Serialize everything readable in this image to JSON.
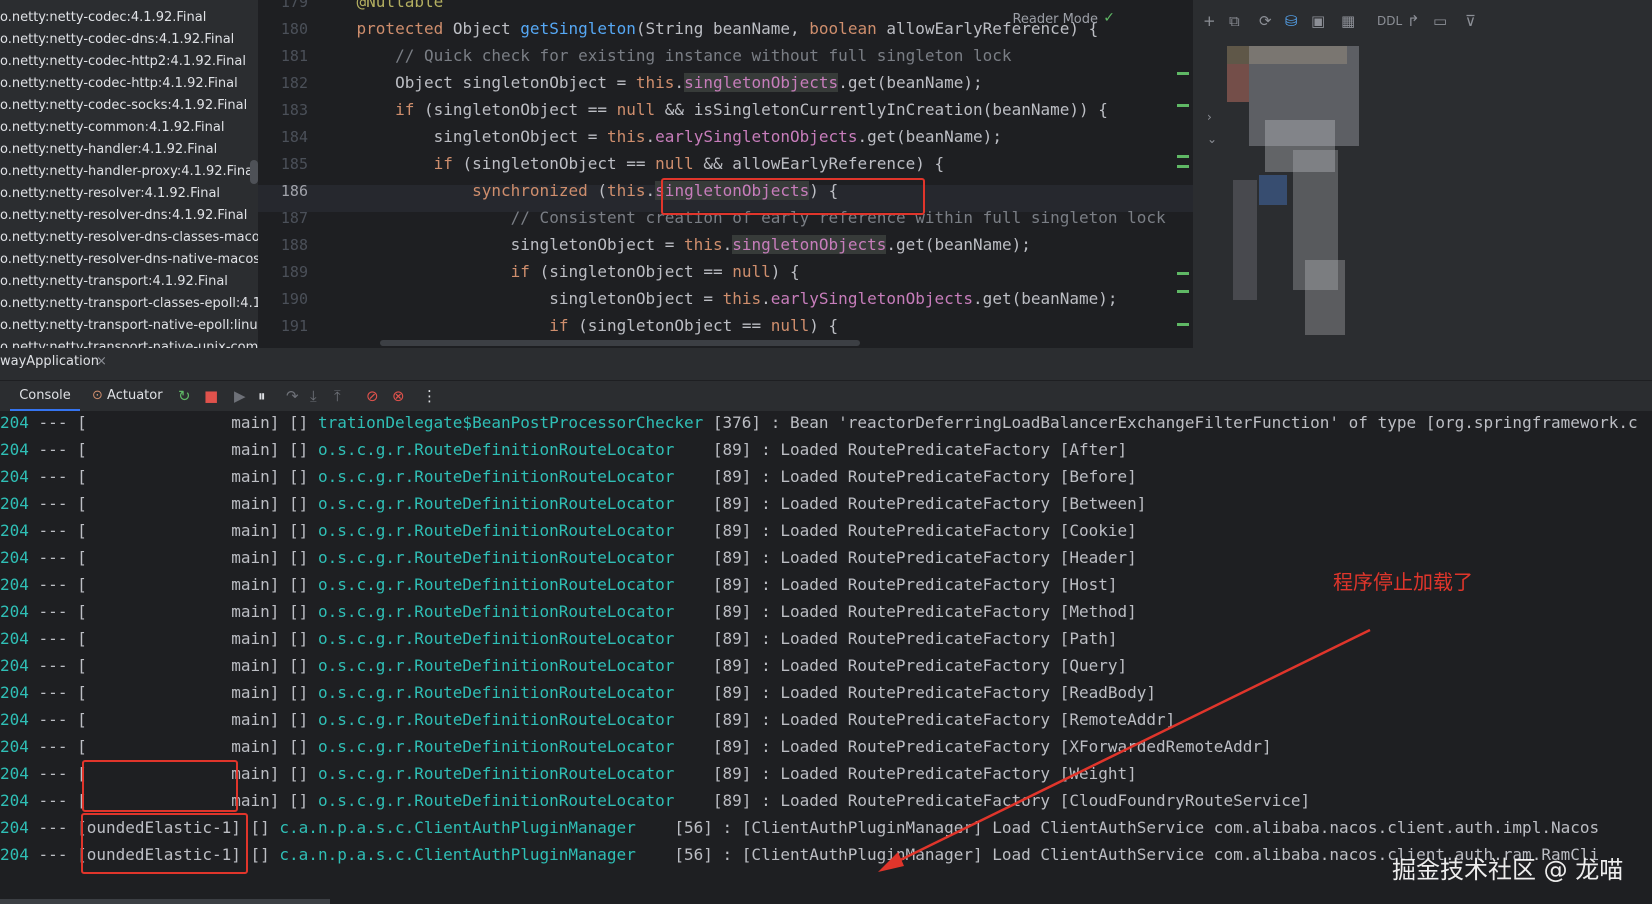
{
  "project_tree": {
    "items": [
      "o.netty:netty-codec:4.1.92.Final",
      "o.netty:netty-codec-dns:4.1.92.Final",
      "o.netty:netty-codec-http2:4.1.92.Final",
      "o.netty:netty-codec-http:4.1.92.Final",
      "o.netty:netty-codec-socks:4.1.92.Final",
      "o.netty:netty-common:4.1.92.Final",
      "o.netty:netty-handler:4.1.92.Final",
      "o.netty:netty-handler-proxy:4.1.92.Final",
      "o.netty:netty-resolver:4.1.92.Final",
      "o.netty:netty-resolver-dns:4.1.92.Final",
      "o.netty:netty-resolver-dns-classes-macos",
      "o.netty:netty-resolver-dns-native-macos:",
      "o.netty:netty-transport:4.1.92.Final",
      "o.netty:netty-transport-classes-epoll:4.1.9",
      "o.netty:netty-transport-native-epoll:linux-",
      "o.netty:netty-transport-native-unix-comm"
    ]
  },
  "editor": {
    "reader_mode": "Reader Mode",
    "current_line": "186",
    "lines": [
      {
        "num": "179",
        "parts": [
          {
            "t": "    @Nullable",
            "c": "ann"
          }
        ]
      },
      {
        "num": "180",
        "parts": [
          {
            "t": "    protected ",
            "c": "kw"
          },
          {
            "t": "Object ",
            "c": ""
          },
          {
            "t": "getSingleton",
            "c": "fn"
          },
          {
            "t": "(String beanName, ",
            "c": ""
          },
          {
            "t": "boolean ",
            "c": "kw"
          },
          {
            "t": "allowEarlyReference) {",
            "c": ""
          }
        ]
      },
      {
        "num": "181",
        "parts": [
          {
            "t": "        // Quick check for existing instance without full singleton lock",
            "c": "cmt"
          }
        ]
      },
      {
        "num": "182",
        "parts": [
          {
            "t": "        Object singletonObject = ",
            "c": ""
          },
          {
            "t": "this",
            "c": "kw"
          },
          {
            "t": ".",
            "c": ""
          },
          {
            "t": "singletonObjects",
            "c": "fieldhl"
          },
          {
            "t": ".get(beanName);",
            "c": ""
          }
        ]
      },
      {
        "num": "183",
        "parts": [
          {
            "t": "        ",
            "c": ""
          },
          {
            "t": "if ",
            "c": "kw"
          },
          {
            "t": "(singletonObject == ",
            "c": ""
          },
          {
            "t": "null ",
            "c": "kw"
          },
          {
            "t": "&& isSingletonCurrentlyInCreation(beanName)) {",
            "c": ""
          }
        ]
      },
      {
        "num": "184",
        "parts": [
          {
            "t": "            singletonObject = ",
            "c": ""
          },
          {
            "t": "this",
            "c": "kw"
          },
          {
            "t": ".",
            "c": ""
          },
          {
            "t": "earlySingletonObjects",
            "c": "field"
          },
          {
            "t": ".get(beanName);",
            "c": ""
          }
        ]
      },
      {
        "num": "185",
        "parts": [
          {
            "t": "            ",
            "c": ""
          },
          {
            "t": "if ",
            "c": "kw"
          },
          {
            "t": "(singletonObject == ",
            "c": ""
          },
          {
            "t": "null ",
            "c": "kw"
          },
          {
            "t": "&& allowEarlyReference) {",
            "c": ""
          }
        ]
      },
      {
        "num": "186",
        "parts": [
          {
            "t": "                ",
            "c": ""
          },
          {
            "t": "synchronized ",
            "c": "kw"
          },
          {
            "t": "(",
            "c": ""
          },
          {
            "t": "this",
            "c": "kw"
          },
          {
            "t": ".",
            "c": ""
          },
          {
            "t": "singletonObjects",
            "c": "fieldhl"
          },
          {
            "t": ") {",
            "c": ""
          }
        ]
      },
      {
        "num": "187",
        "parts": [
          {
            "t": "                    // Consistent creation of early reference within full singleton lock",
            "c": "cmt"
          }
        ]
      },
      {
        "num": "188",
        "parts": [
          {
            "t": "                    singletonObject = ",
            "c": ""
          },
          {
            "t": "this",
            "c": "kw"
          },
          {
            "t": ".",
            "c": ""
          },
          {
            "t": "singletonObjects",
            "c": "fieldhl"
          },
          {
            "t": ".get(beanName);",
            "c": ""
          }
        ]
      },
      {
        "num": "189",
        "parts": [
          {
            "t": "                    ",
            "c": ""
          },
          {
            "t": "if ",
            "c": "kw"
          },
          {
            "t": "(singletonObject == ",
            "c": ""
          },
          {
            "t": "null",
            "c": "kw"
          },
          {
            "t": ") {",
            "c": ""
          }
        ]
      },
      {
        "num": "190",
        "parts": [
          {
            "t": "                        singletonObject = ",
            "c": ""
          },
          {
            "t": "this",
            "c": "kw"
          },
          {
            "t": ".",
            "c": ""
          },
          {
            "t": "earlySingletonObjects",
            "c": "field"
          },
          {
            "t": ".get(beanName);",
            "c": ""
          }
        ]
      },
      {
        "num": "191",
        "parts": [
          {
            "t": "                        ",
            "c": ""
          },
          {
            "t": "if ",
            "c": "kw"
          },
          {
            "t": "(singletonObject == ",
            "c": ""
          },
          {
            "t": "null",
            "c": "kw"
          },
          {
            "t": ") {",
            "c": ""
          }
        ]
      }
    ]
  },
  "right_toolbar": {
    "ddl_label": "DDL"
  },
  "run_window": {
    "app_tab": "wayApplication",
    "tabs": {
      "console": "Console",
      "actuator": "Actuator"
    }
  },
  "console": {
    "lines": [
      {
        "pid": "204",
        "dash": "---",
        "thread": "[               main]",
        "mdc": "[]",
        "logger": "trationDelegate$BeanPostProcessorChecker",
        "line_no": "[376]",
        "msg": ": Bean 'reactorDeferringLoadBalancerExchangeFilterFunction' of type [org.springframework.c"
      },
      {
        "pid": "204",
        "dash": "---",
        "thread": "[               main]",
        "mdc": "[]",
        "logger": "o.s.c.g.r.RouteDefinitionRouteLocator   ",
        "line_no": "[89]",
        "msg": ": Loaded RoutePredicateFactory [After]"
      },
      {
        "pid": "204",
        "dash": "---",
        "thread": "[               main]",
        "mdc": "[]",
        "logger": "o.s.c.g.r.RouteDefinitionRouteLocator   ",
        "line_no": "[89]",
        "msg": ": Loaded RoutePredicateFactory [Before]"
      },
      {
        "pid": "204",
        "dash": "---",
        "thread": "[               main]",
        "mdc": "[]",
        "logger": "o.s.c.g.r.RouteDefinitionRouteLocator   ",
        "line_no": "[89]",
        "msg": ": Loaded RoutePredicateFactory [Between]"
      },
      {
        "pid": "204",
        "dash": "---",
        "thread": "[               main]",
        "mdc": "[]",
        "logger": "o.s.c.g.r.RouteDefinitionRouteLocator   ",
        "line_no": "[89]",
        "msg": ": Loaded RoutePredicateFactory [Cookie]"
      },
      {
        "pid": "204",
        "dash": "---",
        "thread": "[               main]",
        "mdc": "[]",
        "logger": "o.s.c.g.r.RouteDefinitionRouteLocator   ",
        "line_no": "[89]",
        "msg": ": Loaded RoutePredicateFactory [Header]"
      },
      {
        "pid": "204",
        "dash": "---",
        "thread": "[               main]",
        "mdc": "[]",
        "logger": "o.s.c.g.r.RouteDefinitionRouteLocator   ",
        "line_no": "[89]",
        "msg": ": Loaded RoutePredicateFactory [Host]"
      },
      {
        "pid": "204",
        "dash": "---",
        "thread": "[               main]",
        "mdc": "[]",
        "logger": "o.s.c.g.r.RouteDefinitionRouteLocator   ",
        "line_no": "[89]",
        "msg": ": Loaded RoutePredicateFactory [Method]"
      },
      {
        "pid": "204",
        "dash": "---",
        "thread": "[               main]",
        "mdc": "[]",
        "logger": "o.s.c.g.r.RouteDefinitionRouteLocator   ",
        "line_no": "[89]",
        "msg": ": Loaded RoutePredicateFactory [Path]"
      },
      {
        "pid": "204",
        "dash": "---",
        "thread": "[               main]",
        "mdc": "[]",
        "logger": "o.s.c.g.r.RouteDefinitionRouteLocator   ",
        "line_no": "[89]",
        "msg": ": Loaded RoutePredicateFactory [Query]"
      },
      {
        "pid": "204",
        "dash": "---",
        "thread": "[               main]",
        "mdc": "[]",
        "logger": "o.s.c.g.r.RouteDefinitionRouteLocator   ",
        "line_no": "[89]",
        "msg": ": Loaded RoutePredicateFactory [ReadBody]"
      },
      {
        "pid": "204",
        "dash": "---",
        "thread": "[               main]",
        "mdc": "[]",
        "logger": "o.s.c.g.r.RouteDefinitionRouteLocator   ",
        "line_no": "[89]",
        "msg": ": Loaded RoutePredicateFactory [RemoteAddr]"
      },
      {
        "pid": "204",
        "dash": "---",
        "thread": "[               main]",
        "mdc": "[]",
        "logger": "o.s.c.g.r.RouteDefinitionRouteLocator   ",
        "line_no": "[89]",
        "msg": ": Loaded RoutePredicateFactory [XForwardedRemoteAddr]"
      },
      {
        "pid": "204",
        "dash": "---",
        "thread": "[               main]",
        "mdc": "[]",
        "logger": "o.s.c.g.r.RouteDefinitionRouteLocator   ",
        "line_no": "[89]",
        "msg": ": Loaded RoutePredicateFactory [Weight]"
      },
      {
        "pid": "204",
        "dash": "---",
        "thread": "[               main]",
        "mdc": "[]",
        "logger": "o.s.c.g.r.RouteDefinitionRouteLocator   ",
        "line_no": "[89]",
        "msg": ": Loaded RoutePredicateFactory [CloudFoundryRouteService]"
      },
      {
        "pid": "204",
        "dash": "---",
        "thread": "[oundedElastic-1]",
        "mdc": "[]",
        "logger": "c.a.n.p.a.s.c.ClientAuthPluginManager   ",
        "line_no": "[56]",
        "msg": ": [ClientAuthPluginManager] Load ClientAuthService com.alibaba.nacos.client.auth.impl.Nacos"
      },
      {
        "pid": "204",
        "dash": "---",
        "thread": "[oundedElastic-1]",
        "mdc": "[]",
        "logger": "c.a.n.p.a.s.c.ClientAuthPluginManager   ",
        "line_no": "[56]",
        "msg": ": [ClientAuthPluginManager] Load ClientAuthService com.alibaba.nacos.client.auth.ram.RamCli"
      }
    ]
  },
  "annotations": {
    "note": "程序停止加载了",
    "color": "#e0352b"
  },
  "watermark": "掘金技术社区 @ 龙喵",
  "colors": {
    "editor_bg": "#1e1f22",
    "panel_bg": "#2b2d30",
    "keyword": "#cf8e6d",
    "function": "#56a8f5",
    "field": "#c77dbb",
    "comment": "#7a7e85",
    "log_cyan": "#2fbfb6"
  }
}
